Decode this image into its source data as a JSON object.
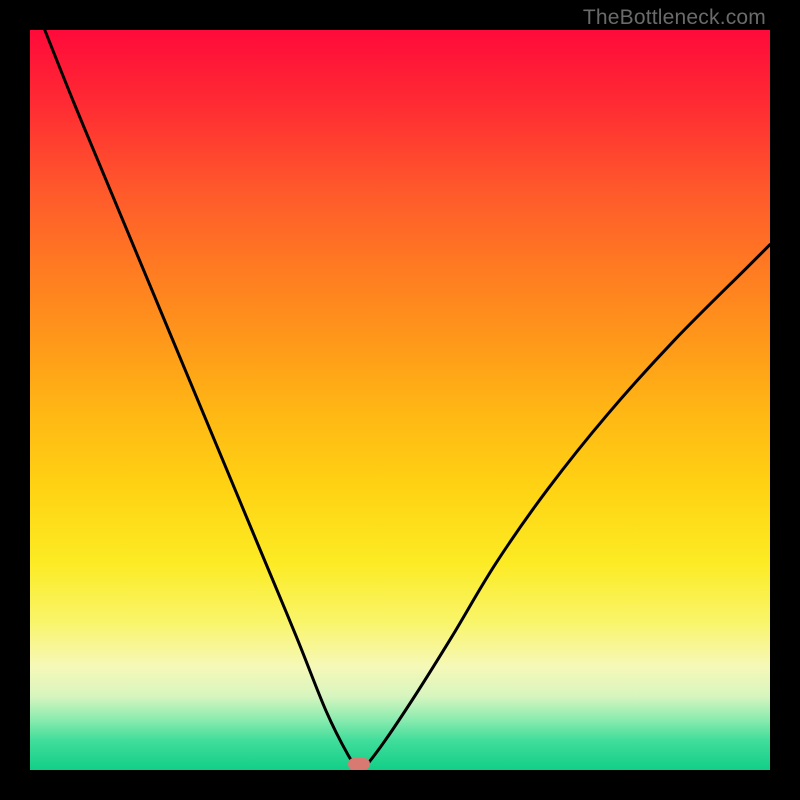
{
  "watermark": "TheBottleneck.com",
  "marker": {
    "x_fraction": 0.445,
    "y_fraction": 0.992,
    "color": "#d87a72"
  },
  "chart_data": {
    "type": "line",
    "title": "",
    "xlabel": "",
    "ylabel": "",
    "xlim": [
      0,
      100
    ],
    "ylim": [
      0,
      100
    ],
    "grid": false,
    "legend": false,
    "annotations": {
      "watermark": "TheBottleneck.com"
    },
    "series": [
      {
        "name": "left_branch",
        "x": [
          2,
          6,
          11,
          16,
          21,
          26,
          31,
          36,
          40,
          43,
          44.5
        ],
        "y": [
          100,
          90,
          78,
          66,
          54,
          42,
          30,
          18,
          8,
          2,
          0
        ]
      },
      {
        "name": "right_branch",
        "x": [
          45,
          48,
          52,
          57,
          63,
          70,
          78,
          87,
          97,
          100
        ],
        "y": [
          0,
          4,
          10,
          18,
          28,
          38,
          48,
          58,
          68,
          71
        ]
      }
    ],
    "minimum_marker": {
      "x": 44.5,
      "y": 0
    },
    "background_gradient": {
      "direction": "top_to_bottom",
      "stops": [
        {
          "pos": 0.0,
          "color": "#ff0a3a"
        },
        {
          "pos": 0.22,
          "color": "#ff5a2b"
        },
        {
          "pos": 0.52,
          "color": "#ffb814"
        },
        {
          "pos": 0.72,
          "color": "#fceb24"
        },
        {
          "pos": 0.9,
          "color": "#d8f5bf"
        },
        {
          "pos": 1.0,
          "color": "#11cf87"
        }
      ]
    }
  }
}
